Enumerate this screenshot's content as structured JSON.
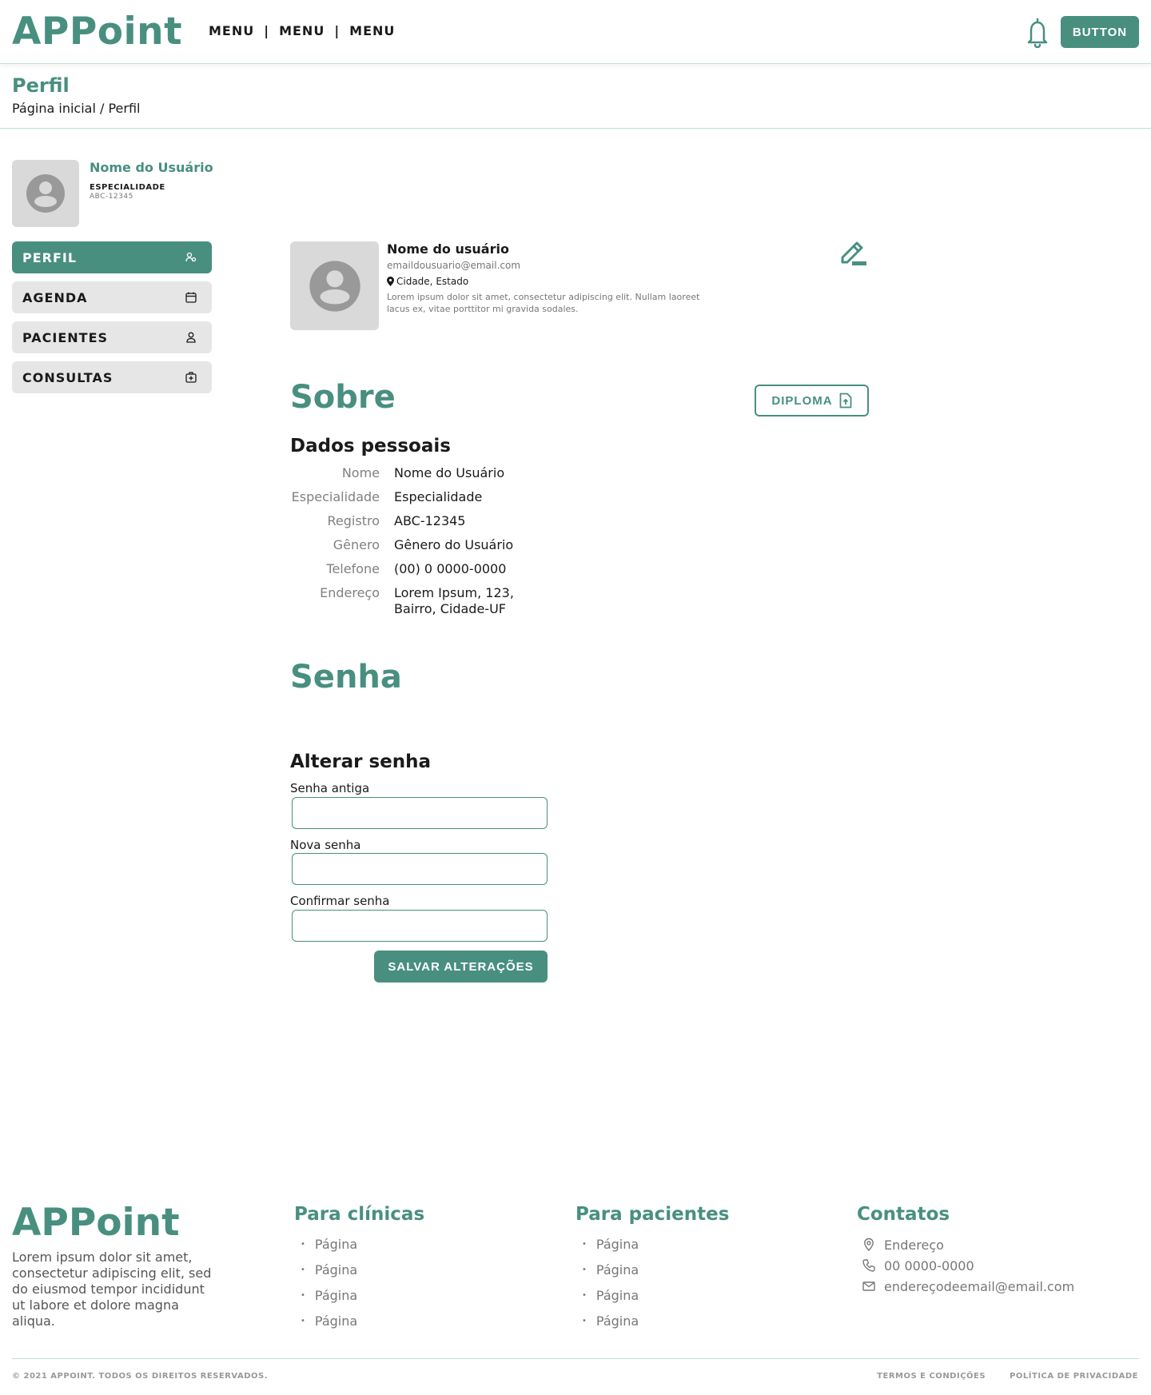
{
  "header": {
    "logo": "APPoint",
    "menu": [
      "MENU",
      "MENU",
      "MENU"
    ],
    "separator": "|",
    "button_label": "BUTTON",
    "bell_icon": "bell-icon"
  },
  "page": {
    "title": "Perfil",
    "breadcrumb": "Página inicial / Perfil"
  },
  "sidebar": {
    "user_name": "Nome do Usuário",
    "specialty": "ESPECIALIDADE",
    "registry": "ABC-12345",
    "items": [
      {
        "label": "PERFIL",
        "icon": "users-icon",
        "active": true
      },
      {
        "label": "AGENDA",
        "icon": "calendar-icon",
        "active": false
      },
      {
        "label": "PACIENTES",
        "icon": "user-icon",
        "active": false
      },
      {
        "label": "CONSULTAS",
        "icon": "medical-kit-icon",
        "active": false
      }
    ]
  },
  "profile": {
    "name": "Nome do usuário",
    "email": "emaildousuario@email.com",
    "location": "Cidade, Estado",
    "description": "Lorem ipsum dolor sit amet, consectetur adipiscing elit. Nullam laoreet lacus ex, vitae porttitor mi gravida sodales."
  },
  "sobre": {
    "title": "Sobre",
    "diploma_label": "DIPLOMA",
    "subtitle": "Dados pessoais",
    "fields": [
      {
        "label": "Nome",
        "value": "Nome do Usuário"
      },
      {
        "label": "Especialidade",
        "value": "Especialidade"
      },
      {
        "label": "Registro",
        "value": "ABC-12345"
      },
      {
        "label": "Gênero",
        "value": "Gênero do Usuário"
      },
      {
        "label": "Telefone",
        "value": "(00) 0 0000-0000"
      },
      {
        "label": "Endereço",
        "value": "Lorem Ipsum, 123,",
        "value2": "Bairro, Cidade-UF"
      }
    ]
  },
  "senha": {
    "title": "Senha",
    "subtitle": "Alterar senha",
    "old_label": "Senha antiga",
    "new_label": "Nova senha",
    "confirm_label": "Confirmar senha",
    "old_value": "",
    "new_value": "",
    "confirm_value": "",
    "save_label": "SALVAR ALTERAÇÕES"
  },
  "footer": {
    "logo": "APPoint",
    "description": "Lorem ipsum dolor sit amet, consectetur adipiscing elit, sed do eiusmod tempor incididunt ut labore et dolore magna aliqua.",
    "clinics_title": "Para clínicas",
    "clinics_links": [
      "Página",
      "Página",
      "Página",
      "Página"
    ],
    "patients_title": "Para pacientes",
    "patients_links": [
      "Página",
      "Página",
      "Página",
      "Página"
    ],
    "contacts_title": "Contatos",
    "address": "Endereço",
    "phone": "00 0000-0000",
    "email": "endereçodeemail@email.com",
    "copyright": "© 2021 APPOINT. TODOS OS DIREITOS RESERVADOS.",
    "terms": "TERMOS E CONDIÇÕES",
    "privacy": "POLÍTICA DE PRIVACIDADE"
  },
  "colors": {
    "accent": "#488f80",
    "light_gray": "#e6e6e6",
    "avatar_gray": "#d9d9d9"
  }
}
